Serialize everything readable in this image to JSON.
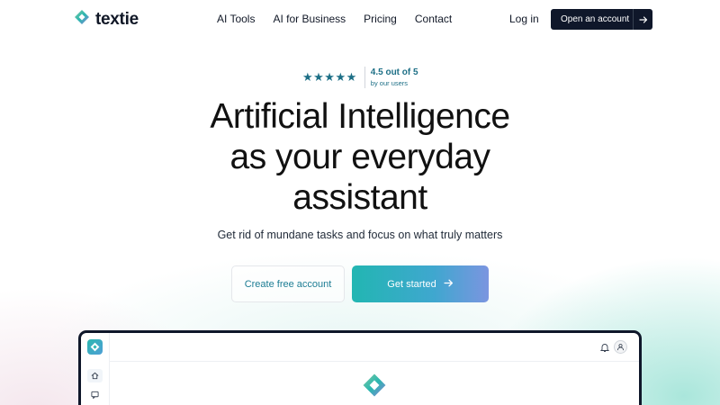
{
  "brand": {
    "name": "textie",
    "accent": "#22b6b2",
    "dark": "#0f172a"
  },
  "nav": {
    "links": [
      {
        "label": "AI Tools"
      },
      {
        "label": "AI for Business"
      },
      {
        "label": "Pricing"
      },
      {
        "label": "Contact"
      }
    ],
    "login_label": "Log in",
    "open_account_label": "Open an account"
  },
  "rating": {
    "stars": "★★★★★",
    "score": "4.5 out of 5",
    "sub": "by our users"
  },
  "hero": {
    "headline_line1": "Artificial Intelligence",
    "headline_line2": "as your everyday",
    "headline_line3": "assistant",
    "subtitle": "Get rid of mundane tasks and focus on what truly matters",
    "cta_secondary": "Create free account",
    "cta_primary": "Get started"
  },
  "icons": {
    "logo": "textie-logo-icon",
    "arrow": "arrow-right-icon",
    "home": "home-icon",
    "chat": "chat-icon",
    "bell": "bell-icon",
    "user": "user-icon"
  }
}
